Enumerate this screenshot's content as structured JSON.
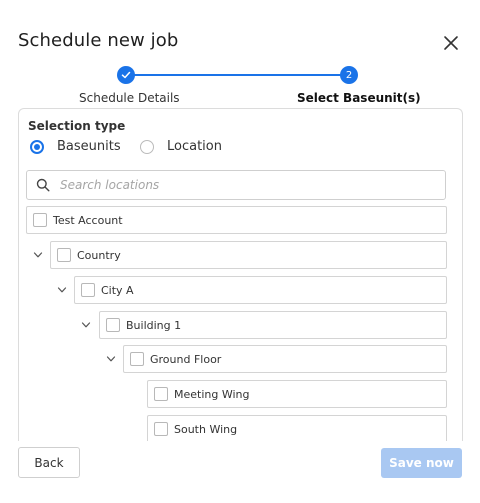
{
  "dialog": {
    "title": "Schedule new job",
    "close_icon": "close-icon"
  },
  "stepper": {
    "steps": [
      {
        "label": "Schedule Details",
        "state": "completed",
        "marker": "✓"
      },
      {
        "label": "Select Baseunit(s)",
        "state": "active",
        "marker": "2"
      }
    ],
    "accent": "#1a73e8"
  },
  "selection": {
    "heading": "Selection type",
    "options": [
      {
        "label": "Baseunits",
        "checked": true
      },
      {
        "label": "Location",
        "checked": false
      }
    ]
  },
  "search": {
    "placeholder": "Search locations",
    "value": "",
    "icon": "search-icon"
  },
  "tree": [
    {
      "label": "Test Account",
      "level": 0,
      "expandable": false,
      "expanded": false,
      "checked": false
    },
    {
      "label": "Country",
      "level": 1,
      "expandable": true,
      "expanded": true,
      "checked": false
    },
    {
      "label": "City A",
      "level": 2,
      "expandable": true,
      "expanded": true,
      "checked": false
    },
    {
      "label": "Building 1",
      "level": 3,
      "expandable": true,
      "expanded": true,
      "checked": false
    },
    {
      "label": "Ground Floor",
      "level": 4,
      "expandable": true,
      "expanded": true,
      "checked": false
    },
    {
      "label": "Meeting Wing",
      "level": 5,
      "expandable": false,
      "expanded": false,
      "checked": false
    },
    {
      "label": "South Wing",
      "level": 5,
      "expandable": false,
      "expanded": false,
      "checked": false
    }
  ],
  "footer": {
    "back_label": "Back",
    "save_label": "Save now",
    "save_disabled": true
  }
}
